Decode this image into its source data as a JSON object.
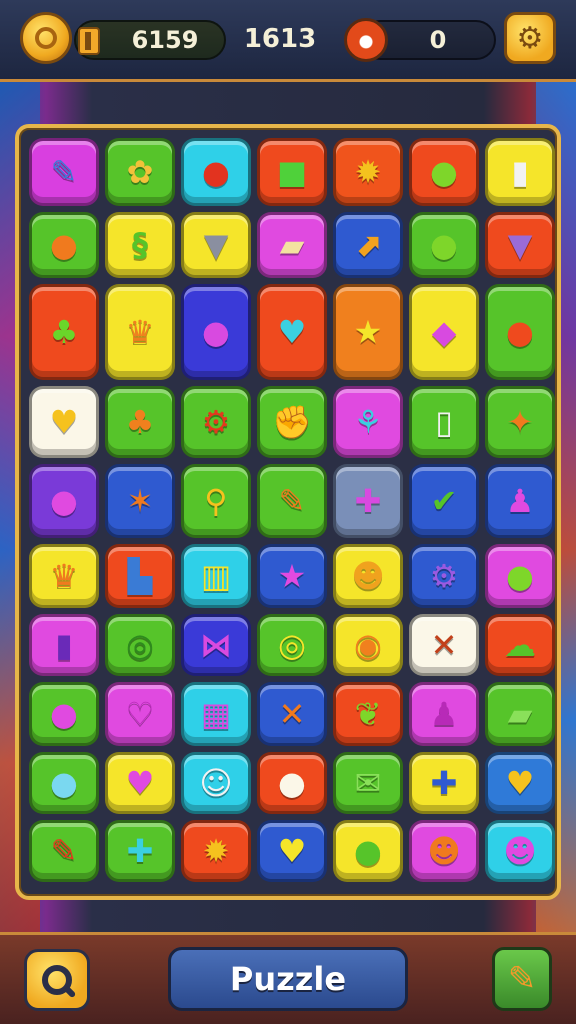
{
  "hud": {
    "coins": "6159",
    "score": "1613",
    "moves": "0",
    "coin_icon": "coin-icon",
    "battery_icon": "battery-icon",
    "donut_icon": "donut-icon",
    "settings_icon": "settings-icon"
  },
  "board": {
    "rows": [
      [
        {
          "bg": "#d93fe0",
          "icon": "lightning-icon",
          "glyph": "✎",
          "fg": "#3a7bd5"
        },
        {
          "bg": "#56c42a",
          "icon": "shell-icon",
          "glyph": "✿",
          "fg": "#f2c23a"
        },
        {
          "bg": "#2fd0e8",
          "icon": "apple-icon",
          "glyph": "●",
          "fg": "#e2331f"
        },
        {
          "bg": "#ef4a1e",
          "icon": "block-icon",
          "glyph": "■",
          "fg": "#4fd13a"
        },
        {
          "bg": "#f0541c",
          "icon": "sun-icon",
          "glyph": "✹",
          "fg": "#f4c21e"
        },
        {
          "bg": "#ef4a1e",
          "icon": "ball-icon",
          "glyph": "●",
          "fg": "#7ed62a"
        },
        {
          "bg": "#f5e52a",
          "icon": "cup-icon",
          "glyph": "▮",
          "fg": "#f2f2f2"
        }
      ],
      [
        {
          "bg": "#56c42a",
          "icon": "bulb-icon",
          "glyph": "●",
          "fg": "#f07a1e"
        },
        {
          "bg": "#f5e52a",
          "icon": "swirl-icon",
          "glyph": "§",
          "fg": "#56c42a"
        },
        {
          "bg": "#f5e52a",
          "icon": "jar-icon",
          "glyph": "▼",
          "fg": "#8a8fa0"
        },
        {
          "bg": "#e04ae0",
          "icon": "paper-icon",
          "glyph": "▰",
          "fg": "#f3e2a0"
        },
        {
          "bg": "#2f5ad0",
          "icon": "arrow-box-icon",
          "glyph": "⬈",
          "fg": "#f2a21e"
        },
        {
          "bg": "#56c42a",
          "icon": "capsule-icon",
          "glyph": "●",
          "fg": "#7ed62a"
        },
        {
          "bg": "#ef4a1e",
          "icon": "shirt-icon",
          "glyph": "▼",
          "fg": "#9a6bd8"
        }
      ],
      [
        {
          "bg": "#ef4a1e",
          "icon": "tree-icon",
          "glyph": "♣",
          "fg": "#6ad62a"
        },
        {
          "bg": "#f5e52a",
          "icon": "cake-icon",
          "glyph": "♛",
          "fg": "#f0801e"
        },
        {
          "bg": "#3a3ad8",
          "icon": "orb-stand-icon",
          "glyph": "●",
          "fg": "#d84ae0"
        },
        {
          "bg": "#ef4a1e",
          "icon": "heart-stand-icon",
          "glyph": "♥",
          "fg": "#3ad0e0"
        },
        {
          "bg": "#f0801e",
          "icon": "star-trophy-icon",
          "glyph": "★",
          "fg": "#f5e52a"
        },
        {
          "bg": "#f5e52a",
          "icon": "gem-stand-icon",
          "glyph": "◆",
          "fg": "#d84ae0"
        },
        {
          "bg": "#56c42a",
          "icon": "ball-stand-icon",
          "glyph": "●",
          "fg": "#ef4a1e"
        }
      ],
      [
        {
          "bg": "#fbf7e8",
          "icon": "shield-icon",
          "glyph": "♥",
          "fg": "#f5c21e"
        },
        {
          "bg": "#56c42a",
          "icon": "pot-icon",
          "glyph": "♣",
          "fg": "#f0801e"
        },
        {
          "bg": "#56c42a",
          "icon": "gear-icon",
          "glyph": "⚙",
          "fg": "#e23a1e"
        },
        {
          "bg": "#56c42a",
          "icon": "fist-icon",
          "glyph": "✊",
          "fg": "#f5e52a"
        },
        {
          "bg": "#e04ae0",
          "icon": "ribbon-icon",
          "glyph": "⚘",
          "fg": "#3ad0e0"
        },
        {
          "bg": "#56c42a",
          "icon": "mug-icon",
          "glyph": "▯",
          "fg": "#f2f2f2"
        },
        {
          "bg": "#56c42a",
          "icon": "star-leaf-icon",
          "glyph": "✦",
          "fg": "#f07a1e"
        }
      ],
      [
        {
          "bg": "#7a3ad8",
          "icon": "balloon-icon",
          "glyph": "●",
          "fg": "#e04ae0"
        },
        {
          "bg": "#2f5ad0",
          "icon": "starfish-icon",
          "glyph": "✶",
          "fg": "#f07a1e"
        },
        {
          "bg": "#56c42a",
          "icon": "magnifier-icon",
          "glyph": "⚲",
          "fg": "#f5c21e"
        },
        {
          "bg": "#56c42a",
          "icon": "carrot-icon",
          "glyph": "✎",
          "fg": "#f07a1e"
        },
        {
          "bg": "#7a8fb8",
          "icon": "cross-icon",
          "glyph": "✚",
          "fg": "#d84ae0"
        },
        {
          "bg": "#2f5ad0",
          "icon": "leaf-icon",
          "glyph": "✔",
          "fg": "#56c42a"
        },
        {
          "bg": "#2f5ad0",
          "icon": "vase-icon",
          "glyph": "♟",
          "fg": "#e04ae0"
        }
      ],
      [
        {
          "bg": "#f5e52a",
          "icon": "crown-icon",
          "glyph": "♛",
          "fg": "#f07a1e"
        },
        {
          "bg": "#ef4a1e",
          "icon": "l-block-icon",
          "glyph": "▙",
          "fg": "#3a7bd5"
        },
        {
          "bg": "#2fd0e8",
          "icon": "gate-icon",
          "glyph": "▥",
          "fg": "#f5e52a"
        },
        {
          "bg": "#2f5ad0",
          "icon": "star-icon",
          "glyph": "★",
          "fg": "#e04ae0"
        },
        {
          "bg": "#f5e52a",
          "icon": "bear-icon",
          "glyph": "☻",
          "fg": "#f0a21e"
        },
        {
          "bg": "#2f5ad0",
          "icon": "cog-icon",
          "glyph": "⚙",
          "fg": "#9a5ae0"
        },
        {
          "bg": "#e04ae0",
          "icon": "melon-icon",
          "glyph": "●",
          "fg": "#7ed62a"
        }
      ],
      [
        {
          "bg": "#e04ae0",
          "icon": "card-icon",
          "glyph": "▮",
          "fg": "#6a2ab8"
        },
        {
          "bg": "#56c42a",
          "icon": "ring-icon",
          "glyph": "◎",
          "fg": "#2e8a1e"
        },
        {
          "bg": "#3a3ad8",
          "icon": "bow-icon",
          "glyph": "⋈",
          "fg": "#d84ae0"
        },
        {
          "bg": "#56c42a",
          "icon": "target-icon",
          "glyph": "◎",
          "fg": "#f5e52a"
        },
        {
          "bg": "#f5e52a",
          "icon": "coin-token-icon",
          "glyph": "◉",
          "fg": "#f0801e"
        },
        {
          "bg": "#fbf7e8",
          "icon": "pencil-icon",
          "glyph": "✕",
          "fg": "#c2401a"
        },
        {
          "bg": "#ef4a1e",
          "icon": "cloud-icon",
          "glyph": "☁",
          "fg": "#56c42a"
        }
      ],
      [
        {
          "bg": "#56c42a",
          "icon": "berry-icon",
          "glyph": "●",
          "fg": "#e04ae0"
        },
        {
          "bg": "#e04ae0",
          "icon": "heart-outline-icon",
          "glyph": "♡",
          "fg": "#b82ab8"
        },
        {
          "bg": "#2fd0e8",
          "icon": "calculator-icon",
          "glyph": "▦",
          "fg": "#d84ae0"
        },
        {
          "bg": "#2f5ad0",
          "icon": "x-icon",
          "glyph": "✕",
          "fg": "#f07a1e"
        },
        {
          "bg": "#ef4a1e",
          "icon": "leaf-green-icon",
          "glyph": "❦",
          "fg": "#7ed62a"
        },
        {
          "bg": "#e04ae0",
          "icon": "joystick-icon",
          "glyph": "♟",
          "fg": "#b82ab8"
        },
        {
          "bg": "#56c42a",
          "icon": "bar-icon",
          "glyph": "▰",
          "fg": "#8ae05a"
        }
      ],
      [
        {
          "bg": "#56c42a",
          "icon": "apple-blue-icon",
          "glyph": "●",
          "fg": "#7ad8f0"
        },
        {
          "bg": "#f5e52a",
          "icon": "heart-icon",
          "glyph": "♥",
          "fg": "#e04ae0"
        },
        {
          "bg": "#2fd0e8",
          "icon": "face-icon",
          "glyph": "☺",
          "fg": "#f2f2f2"
        },
        {
          "bg": "#ef4a1e",
          "icon": "marshmallow-icon",
          "glyph": "●",
          "fg": "#fbf7e8"
        },
        {
          "bg": "#56c42a",
          "icon": "envelope-icon",
          "glyph": "✉",
          "fg": "#8ae05a"
        },
        {
          "bg": "#f5e52a",
          "icon": "fish-icon",
          "glyph": "✚",
          "fg": "#2f5ad0"
        },
        {
          "bg": "#2f7ad8",
          "icon": "heart-gold-icon",
          "glyph": "♥",
          "fg": "#f5c21e"
        }
      ],
      [
        {
          "bg": "#56c42a",
          "icon": "pen-icon",
          "glyph": "✎",
          "fg": "#e23a1e"
        },
        {
          "bg": "#56c42a",
          "icon": "bone-icon",
          "glyph": "✚",
          "fg": "#3ad0e0"
        },
        {
          "bg": "#ef4a1e",
          "icon": "sun-face-icon",
          "glyph": "✹",
          "fg": "#f5c21e"
        },
        {
          "bg": "#2f5ad0",
          "icon": "tulip-icon",
          "glyph": "♥",
          "fg": "#f5e52a"
        },
        {
          "bg": "#f5e52a",
          "icon": "lime-icon",
          "glyph": "●",
          "fg": "#56c42a"
        },
        {
          "bg": "#e04ae0",
          "icon": "pumpkin-icon",
          "glyph": "☻",
          "fg": "#f07a1e"
        },
        {
          "bg": "#2fd0e8",
          "icon": "monster-icon",
          "glyph": "☻",
          "fg": "#e04ae0"
        }
      ]
    ]
  },
  "bottom": {
    "mode_label": "Puzzle",
    "search_icon": "search-icon",
    "edit_icon": "edit-icon"
  }
}
